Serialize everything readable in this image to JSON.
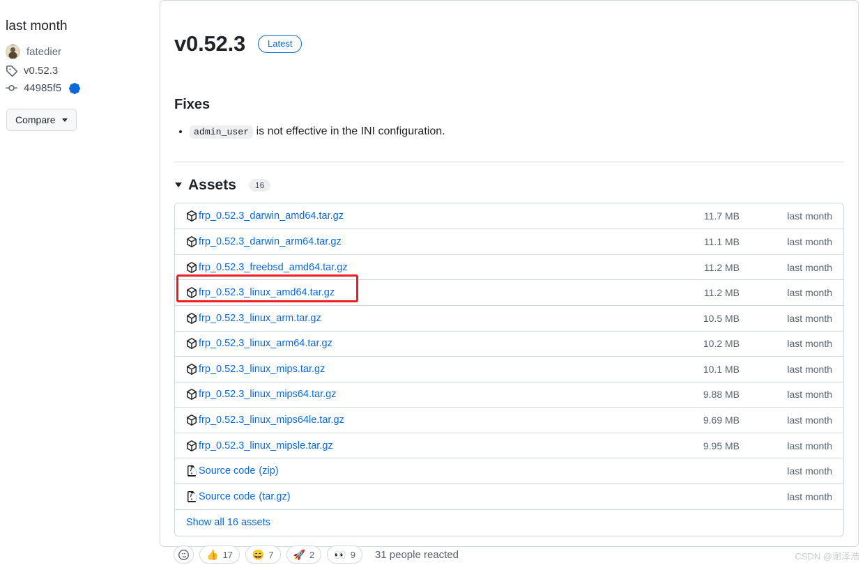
{
  "sidebar": {
    "date": "last month",
    "author": "fatedier",
    "tag": "v0.52.3",
    "commit": "44985f5",
    "compare_label": "Compare"
  },
  "release": {
    "version": "v0.52.3",
    "latest_badge": "Latest",
    "fixes_heading": "Fixes",
    "fix_items": [
      {
        "code": "admin_user",
        "text": "is not effective in the INI configuration."
      }
    ]
  },
  "assets": {
    "title": "Assets",
    "count": "16",
    "show_all_label": "Show all 16 assets",
    "rows": [
      {
        "name": "frp_0.52.3_darwin_amd64.tar.gz",
        "suffix": "",
        "size": "11.7 MB",
        "date": "last month",
        "icon": "package-icon"
      },
      {
        "name": "frp_0.52.3_darwin_arm64.tar.gz",
        "suffix": "",
        "size": "11.1 MB",
        "date": "last month",
        "icon": "package-icon"
      },
      {
        "name": "frp_0.52.3_freebsd_amd64.tar.gz",
        "suffix": "",
        "size": "11.2 MB",
        "date": "last month",
        "icon": "package-icon"
      },
      {
        "name": "frp_0.52.3_linux_amd64.tar.gz",
        "suffix": "",
        "size": "11.2 MB",
        "date": "last month",
        "icon": "package-icon"
      },
      {
        "name": "frp_0.52.3_linux_arm.tar.gz",
        "suffix": "",
        "size": "10.5 MB",
        "date": "last month",
        "icon": "package-icon"
      },
      {
        "name": "frp_0.52.3_linux_arm64.tar.gz",
        "suffix": "",
        "size": "10.2 MB",
        "date": "last month",
        "icon": "package-icon"
      },
      {
        "name": "frp_0.52.3_linux_mips.tar.gz",
        "suffix": "",
        "size": "10.1 MB",
        "date": "last month",
        "icon": "package-icon"
      },
      {
        "name": "frp_0.52.3_linux_mips64.tar.gz",
        "suffix": "",
        "size": "9.88 MB",
        "date": "last month",
        "icon": "package-icon"
      },
      {
        "name": "frp_0.52.3_linux_mips64le.tar.gz",
        "suffix": "",
        "size": "9.69 MB",
        "date": "last month",
        "icon": "package-icon"
      },
      {
        "name": "frp_0.52.3_linux_mipsle.tar.gz",
        "suffix": "",
        "size": "9.95 MB",
        "date": "last month",
        "icon": "package-icon"
      },
      {
        "name": "Source code",
        "suffix": "(zip)",
        "size": "",
        "date": "last month",
        "icon": "file-zip-icon"
      },
      {
        "name": "Source code",
        "suffix": "(tar.gz)",
        "size": "",
        "date": "last month",
        "icon": "file-zip-icon"
      }
    ]
  },
  "reactions": {
    "add_label": "add-reaction",
    "items": [
      {
        "emoji": "👍",
        "count": "17"
      },
      {
        "emoji": "😄",
        "count": "7"
      },
      {
        "emoji": "🚀",
        "count": "2"
      },
      {
        "emoji": "👀",
        "count": "9"
      }
    ],
    "summary": "31 people reacted"
  },
  "watermark": "CSDN @谢泽浩",
  "colors": {
    "link": "#0969da",
    "border": "#d1d9e0",
    "muted": "#59636e",
    "highlight": "#ee1b24"
  }
}
